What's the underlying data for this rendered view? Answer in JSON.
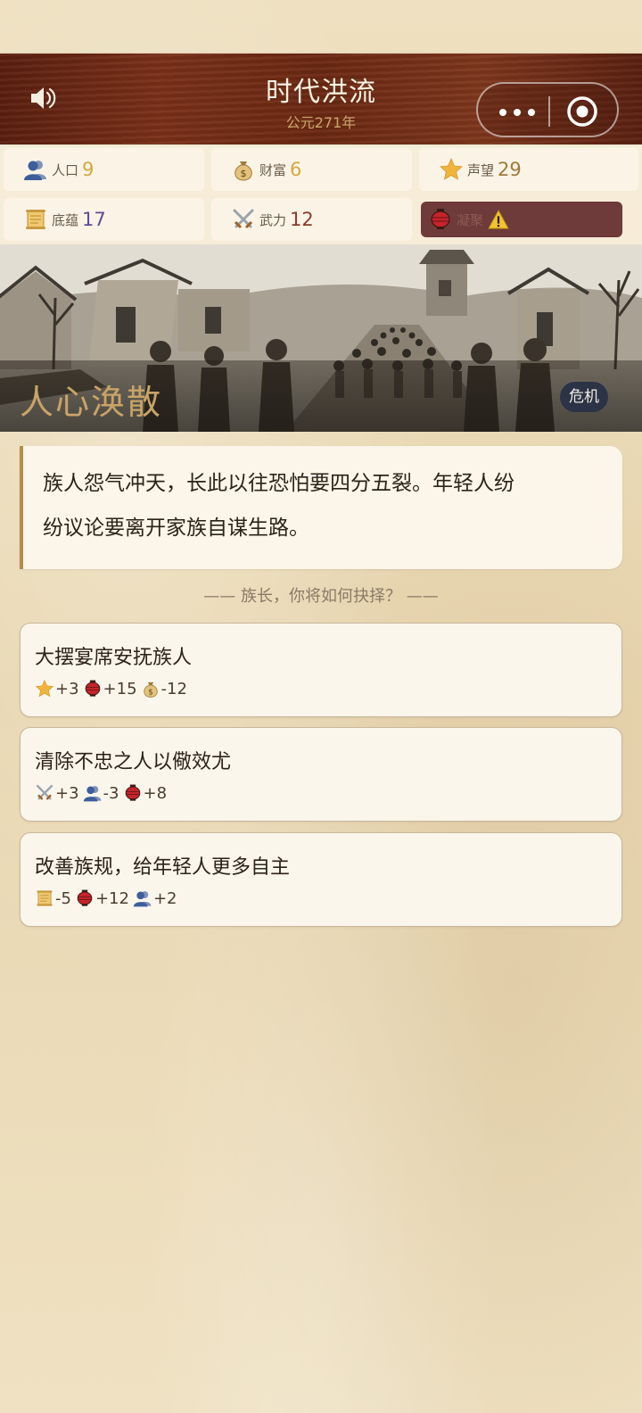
{
  "header": {
    "title": "时代洪流",
    "subtitle": "公元271年"
  },
  "stats": [
    {
      "icon": "population-icon",
      "label": "人口",
      "value": "9",
      "color": "#d8a640"
    },
    {
      "icon": "money-bag-icon",
      "label": "财富",
      "value": "6",
      "color": "#d8a640"
    },
    {
      "icon": "star-icon",
      "label": "声望",
      "value": "29",
      "color": "#a27a3a"
    },
    {
      "icon": "scroll-icon",
      "label": "底蕴",
      "value": "17",
      "color": "#5b4a9a"
    },
    {
      "icon": "swords-icon",
      "label": "武力",
      "value": "12",
      "color": "#8e3a2a"
    },
    {
      "icon": "lantern-icon",
      "label": "凝聚",
      "value": "",
      "color": "#a84040",
      "warning": true
    }
  ],
  "event": {
    "title": "人心涣散",
    "badge": "危机",
    "description_line1": "族人怨气冲天，长此以往恐怕要四分五裂。年轻人纷",
    "description_line2": "纷议论要离开家族自谋生路。"
  },
  "prompt": "—— 族长，你将如何抉择？ ——",
  "choices": [
    {
      "title": "大摆宴席安抚族人",
      "effects": [
        {
          "icon": "star-icon",
          "value": "+3"
        },
        {
          "icon": "lantern-icon",
          "value": "+15"
        },
        {
          "icon": "money-bag-icon",
          "value": "-12"
        }
      ]
    },
    {
      "title": "清除不忠之人以儆效尤",
      "effects": [
        {
          "icon": "swords-icon",
          "value": "+3"
        },
        {
          "icon": "population-icon",
          "value": "-3"
        },
        {
          "icon": "lantern-icon",
          "value": "+8"
        }
      ]
    },
    {
      "title": "改善族规，给年轻人更多自主",
      "effects": [
        {
          "icon": "scroll-icon",
          "value": "-5"
        },
        {
          "icon": "lantern-icon",
          "value": "+12"
        },
        {
          "icon": "population-icon",
          "value": "+2"
        }
      ]
    }
  ]
}
